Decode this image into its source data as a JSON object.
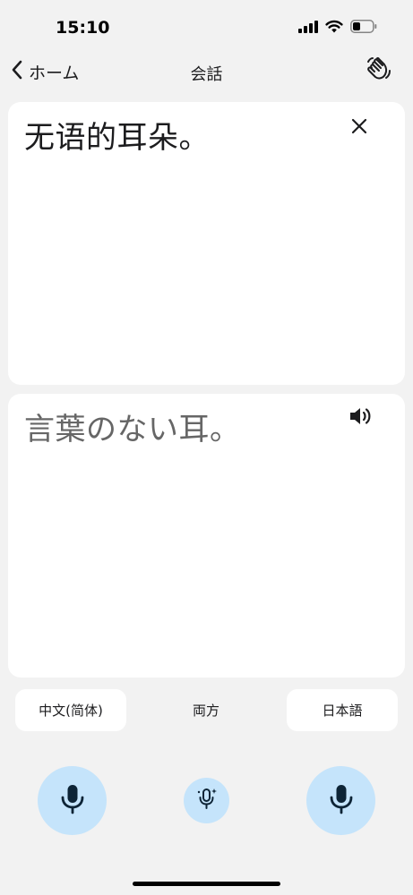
{
  "status_bar": {
    "time": "15:10"
  },
  "nav": {
    "back_label": "ホーム",
    "title": "会話"
  },
  "source_panel": {
    "text": "无语的耳朵。"
  },
  "target_panel": {
    "text": "言葉のない耳。"
  },
  "languages": {
    "left": "中文(简体)",
    "both": "両方",
    "right": "日本語"
  },
  "colors": {
    "mic_bg": "#c5e4fb",
    "background": "#f2f2f2",
    "panel": "#ffffff"
  }
}
